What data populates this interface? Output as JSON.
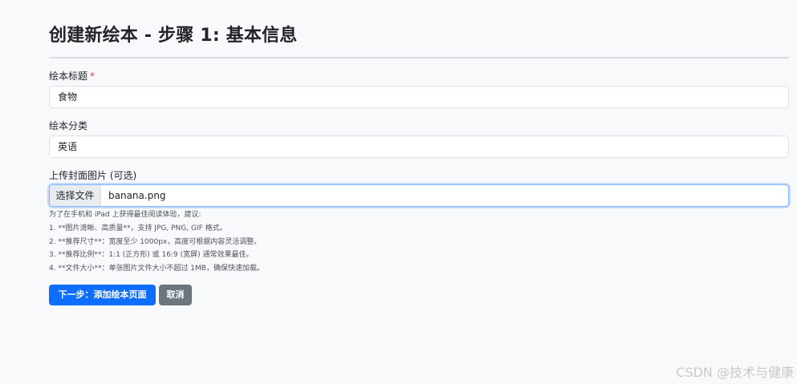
{
  "header": {
    "title": "创建新绘本 - 步骤 1: 基本信息"
  },
  "form": {
    "title_field": {
      "label": "绘本标题",
      "required_mark": "*",
      "value": "食物"
    },
    "category_field": {
      "label": "绘本分类",
      "value": "英语"
    },
    "cover_field": {
      "label": "上传封面图片 (可选)",
      "button_label": "选择文件",
      "file_name": "banana.png"
    },
    "help_lines": [
      "为了在手机和 iPad 上获得最佳阅读体验，建议:",
      "1. **图片清晰、高质量**，支持 JPG, PNG, GIF 格式。",
      "2. **推荐尺寸**：宽度至少 1000px，高度可根据内容灵活调整。",
      "3. **推荐比例**：1:1 (正方形) 或 16:9 (宽屏) 通常效果最佳。",
      "4. **文件大小**：单张图片文件大小不超过 1MB，确保快速加载。"
    ]
  },
  "actions": {
    "next_label": "下一步：添加绘本页面",
    "cancel_label": "取消"
  },
  "watermark": "CSDN @技术与健康",
  "colors": {
    "primary": "#0d6efd",
    "secondary": "#6c757d",
    "required": "#dc3545",
    "background": "#f8f9fa"
  }
}
